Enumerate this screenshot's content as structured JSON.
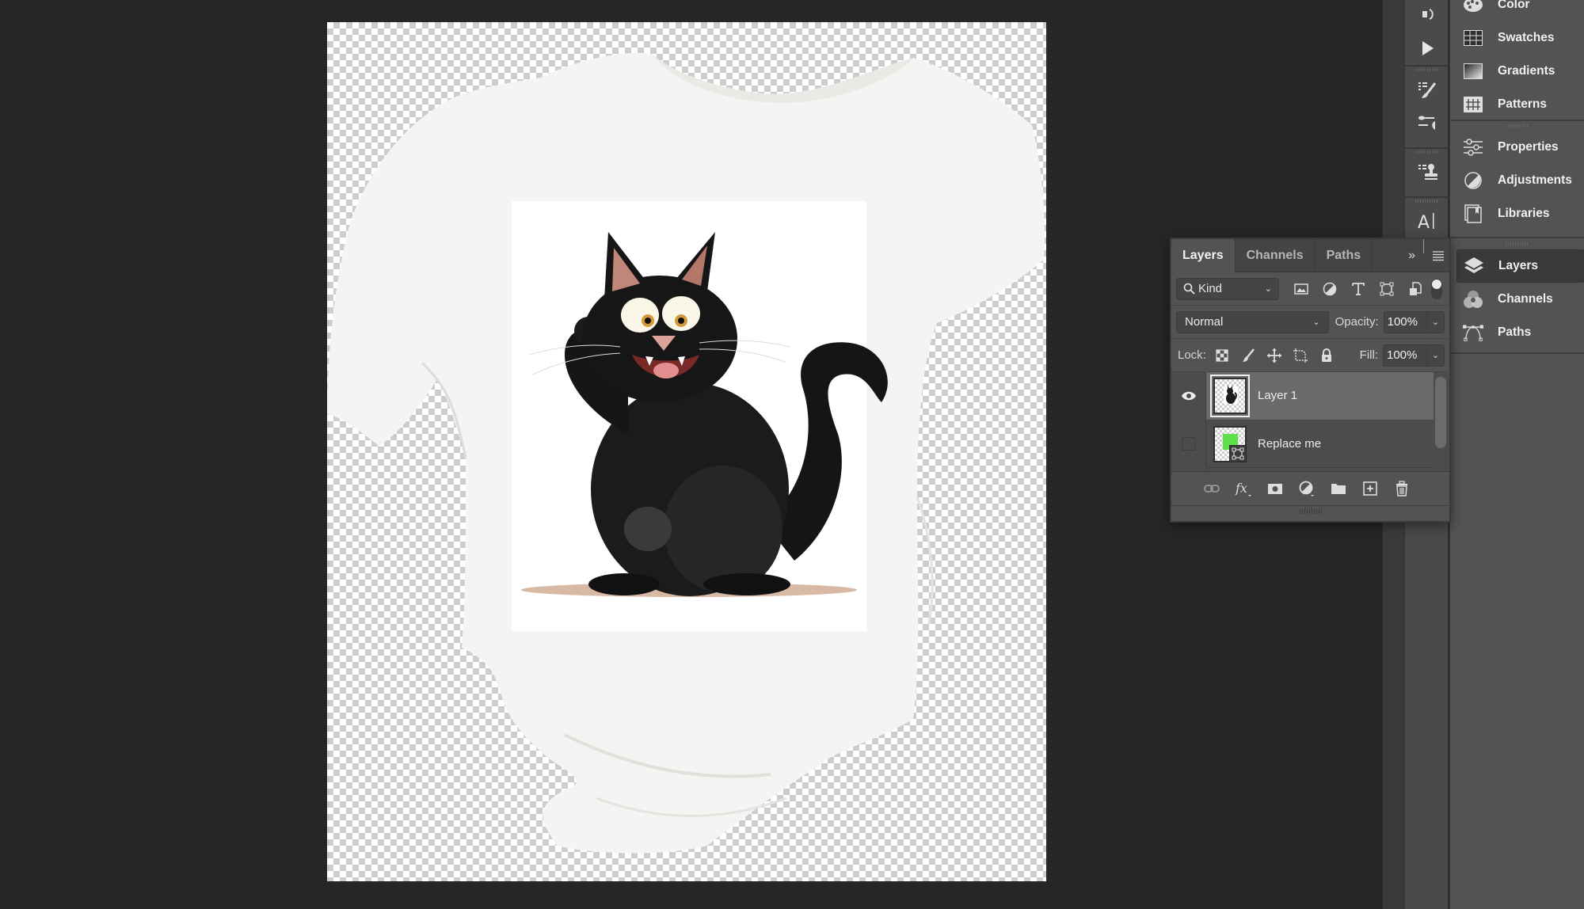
{
  "app": "Adobe Photoshop",
  "canvas": {
    "document_content": "White t-shirt mockup with black cartoon cat print on transparent background",
    "print_image": "Cartoon black cat waving, sitting on beige shadow"
  },
  "dock": {
    "icons": [
      "history-icon",
      "play-actions-icon",
      "brush-settings-icon",
      "brush-presets-icon",
      "clone-source-icon",
      "character-icon"
    ]
  },
  "panels_collapsed": {
    "group1": [
      {
        "label": "Color",
        "icon": "color-palette-icon"
      },
      {
        "label": "Swatches",
        "icon": "swatches-icon"
      },
      {
        "label": "Gradients",
        "icon": "gradients-icon"
      },
      {
        "label": "Patterns",
        "icon": "patterns-icon"
      }
    ],
    "group2": [
      {
        "label": "Properties",
        "icon": "properties-icon"
      },
      {
        "label": "Adjustments",
        "icon": "adjustments-icon"
      },
      {
        "label": "Libraries",
        "icon": "libraries-icon"
      }
    ],
    "group3": [
      {
        "label": "Layers",
        "icon": "layers-icon",
        "active": true
      },
      {
        "label": "Channels",
        "icon": "channels-icon"
      },
      {
        "label": "Paths",
        "icon": "paths-icon"
      }
    ]
  },
  "layers_panel": {
    "tabs": [
      {
        "label": "Layers",
        "active": true
      },
      {
        "label": "Channels",
        "active": false
      },
      {
        "label": "Paths",
        "active": false
      }
    ],
    "expand_icon": "»",
    "filter": {
      "kind_label": "Kind",
      "filters": [
        "pixel-filter-icon",
        "adjustment-filter-icon",
        "type-filter-icon",
        "shape-filter-icon",
        "smart-object-filter-icon"
      ]
    },
    "blend_mode": "Normal",
    "opacity_label": "Opacity:",
    "opacity_value": "100%",
    "lock_label": "Lock:",
    "fill_label": "Fill:",
    "fill_value": "100%",
    "layers": [
      {
        "name": "Layer 1",
        "visible": true,
        "selected": true
      },
      {
        "name": "Replace me",
        "visible": false,
        "selected": false,
        "smart_object": true,
        "thumb_color": "#5ee04c"
      }
    ],
    "footer": [
      "link-layers-icon",
      "fx-icon",
      "add-mask-icon",
      "adjustment-layer-icon",
      "new-group-icon",
      "new-layer-icon",
      "delete-layer-icon"
    ]
  }
}
